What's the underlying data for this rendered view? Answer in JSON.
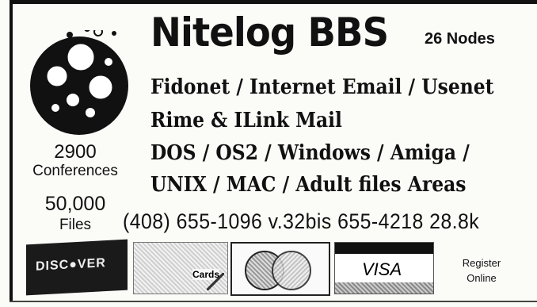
{
  "ad": {
    "title": "Nitelog BBS",
    "nodes": "26 Nodes",
    "lines": [
      "Fidonet / Internet Email / Usenet",
      "Rime & ILink Mail",
      "DOS / OS2 / Windows / Amiga /",
      "UNIX / MAC / Adult files Areas"
    ],
    "conferences_count": "2900",
    "conferences_label": "Conferences",
    "files_count": "50,000",
    "files_label": "Files",
    "phone_line": "(408) 655-1096 v.32bis 655-4218 28.8k",
    "register_line1": "Register",
    "register_line2": "Online"
  },
  "cards": {
    "discover_label": "DISC●VER",
    "amex_label": "Cards",
    "visa_label": "VISA"
  }
}
